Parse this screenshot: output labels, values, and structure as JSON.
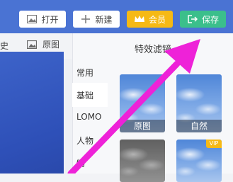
{
  "toolbar": {
    "open_label": "打开",
    "new_label": "新建",
    "vip_label": "会员",
    "save_label": "保存"
  },
  "subbar": {
    "cut_label": "史",
    "original_label": "原图"
  },
  "panel": {
    "title": "特效滤镜",
    "categories": [
      "常用",
      "基础",
      "LOMO",
      "人物",
      "物"
    ],
    "thumbs": [
      {
        "label": "原图"
      },
      {
        "label": "自然"
      },
      {
        "label": ""
      },
      {
        "label": "",
        "badge": "VIP"
      }
    ]
  },
  "colors": {
    "topbar": "#4a73d3",
    "vip": "#f6b915",
    "save": "#3bbf8b",
    "arrow": "#ee22d8"
  },
  "icons": {
    "open": "image-icon",
    "new": "plus-icon",
    "vip": "crown-icon",
    "save": "save-exit-icon"
  }
}
